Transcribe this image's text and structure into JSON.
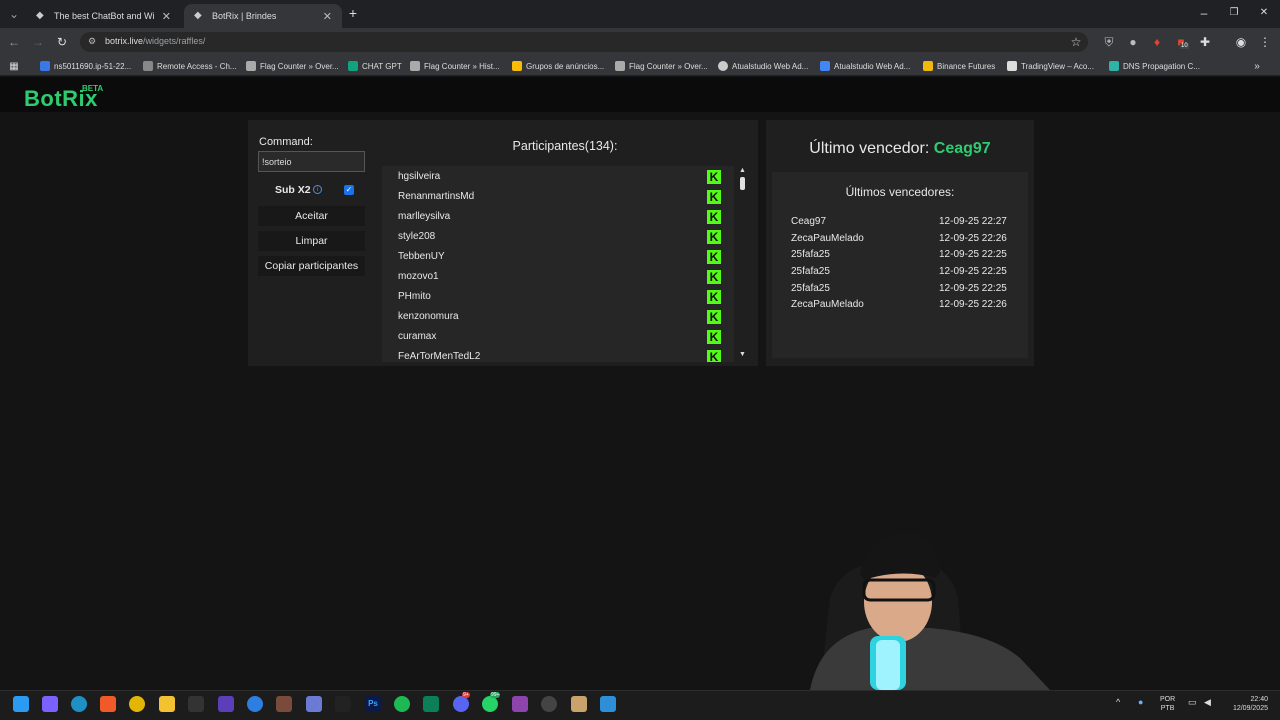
{
  "browser": {
    "tabs": [
      {
        "title": "The best ChatBot and Widgets",
        "active": false
      },
      {
        "title": "BotRix | Brindes",
        "active": true
      }
    ],
    "url_host": "botrix.live",
    "url_path": "/widgets/raffles/",
    "extension_badge": "10",
    "bookmarks": [
      "ns5011690.ip-51-22...",
      "Remote Access - Ch...",
      "Flag Counter » Over...",
      "CHAT GPT",
      "Flag Counter » Hist...",
      "Grupos de anúncios...",
      "Flag Counter » Over...",
      "Atualstudio Web Ad...",
      "Atualstudio Web Ad...",
      "Binance Futures",
      "TradingView – Aco...",
      "DNS Propagation C..."
    ]
  },
  "site": {
    "logo": "BotRix",
    "logo_badge": "BETA"
  },
  "controls": {
    "command_label": "Command:",
    "command_value": "!sorteio",
    "sub_label": "Sub X2",
    "sub_checked": true,
    "accept_label": "Aceitar",
    "clear_label": "Limpar",
    "copy_label": "Copiar participantes"
  },
  "participants": {
    "title": "Participantes(134):",
    "items": [
      "hgsilveira",
      "RenanmartinsMd",
      "marlleysilva",
      "style208",
      "TebbenUY",
      "mozovo1",
      "PHmito",
      "kenzonomura",
      "curamax",
      "FeArTorMenTedL2"
    ],
    "platform_icon": "kick-icon",
    "platform_color": "#53fc18"
  },
  "winners": {
    "last_label": "Último vencedor:",
    "last_name": "Ceag97",
    "history_title": "Últimos vencedores:",
    "history": [
      {
        "name": "Ceag97",
        "date": "12-09-25 22:27"
      },
      {
        "name": "ZecaPauMelado",
        "date": "12-09-25 22:26"
      },
      {
        "name": "25fafa25",
        "date": "12-09-25 22:25"
      },
      {
        "name": "25fafa25",
        "date": "12-09-25 22:25"
      },
      {
        "name": "25fafa25",
        "date": "12-09-25 22:25"
      },
      {
        "name": "ZecaPauMelado",
        "date": "12-09-25 22:26"
      }
    ]
  },
  "taskbar": {
    "lang_1": "POR",
    "lang_2": "PTB",
    "time": "22:40",
    "date": "12/09/2025",
    "whatsapp_badge": "99+",
    "discord_badge": "9+"
  },
  "colors": {
    "accent_green": "#2ecc71",
    "kick_green": "#53fc18",
    "checkbox_blue": "#1a73e8"
  }
}
